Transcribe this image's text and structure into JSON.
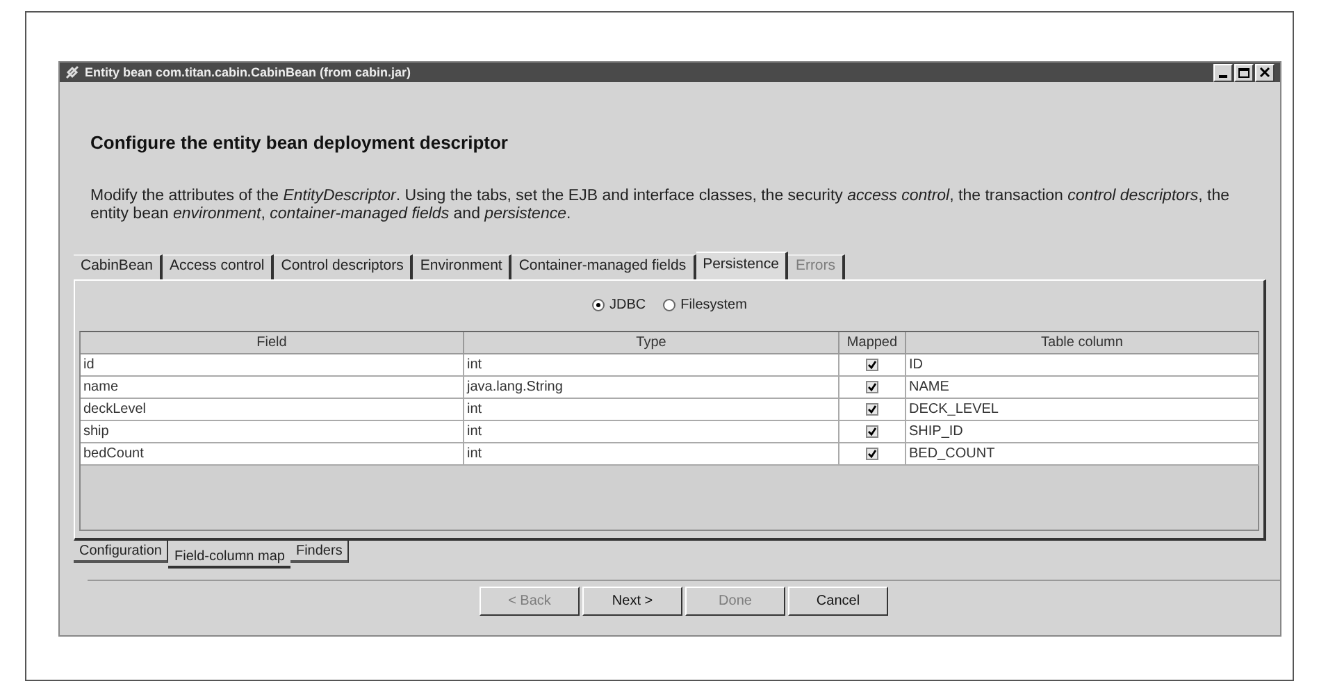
{
  "window": {
    "title": "Entity bean com.titan.cabin.CabinBean (from cabin.jar)"
  },
  "heading": "Configure the entity bean deployment descriptor",
  "description": "Modify the attributes of the *EntityDescriptor*. Using the tabs, set the EJB and interface classes, the security *access control*, the transaction *control descriptors*, the entity bean *environment*, *container-managed fields* and *persistence*.",
  "tabs": [
    {
      "label": "CabinBean",
      "selected": false,
      "disabled": false
    },
    {
      "label": "Access control",
      "selected": false,
      "disabled": false
    },
    {
      "label": "Control descriptors",
      "selected": false,
      "disabled": false
    },
    {
      "label": "Environment",
      "selected": false,
      "disabled": false
    },
    {
      "label": "Container-managed fields",
      "selected": false,
      "disabled": false
    },
    {
      "label": "Persistence",
      "selected": true,
      "disabled": false
    },
    {
      "label": "Errors",
      "selected": false,
      "disabled": true
    }
  ],
  "storage": [
    {
      "label": "JDBC",
      "selected": true
    },
    {
      "label": "Filesystem",
      "selected": false
    }
  ],
  "table": {
    "columns": [
      "Field",
      "Type",
      "Mapped",
      "Table column"
    ],
    "rows": [
      {
        "field": "id",
        "type": "int",
        "mapped": true,
        "column": "ID"
      },
      {
        "field": "name",
        "type": "java.lang.String",
        "mapped": true,
        "column": "NAME"
      },
      {
        "field": "deckLevel",
        "type": "int",
        "mapped": true,
        "column": "DECK_LEVEL"
      },
      {
        "field": "ship",
        "type": "int",
        "mapped": true,
        "column": "SHIP_ID"
      },
      {
        "field": "bedCount",
        "type": "int",
        "mapped": true,
        "column": "BED_COUNT"
      }
    ]
  },
  "subtabs": [
    {
      "label": "Configuration",
      "selected": false
    },
    {
      "label": "Field-column map",
      "selected": true
    },
    {
      "label": "Finders",
      "selected": false
    }
  ],
  "buttons": [
    {
      "label": "< Back",
      "disabled": true
    },
    {
      "label": "Next >",
      "disabled": false
    },
    {
      "label": "Done",
      "disabled": true
    },
    {
      "label": "Cancel",
      "disabled": false
    }
  ]
}
